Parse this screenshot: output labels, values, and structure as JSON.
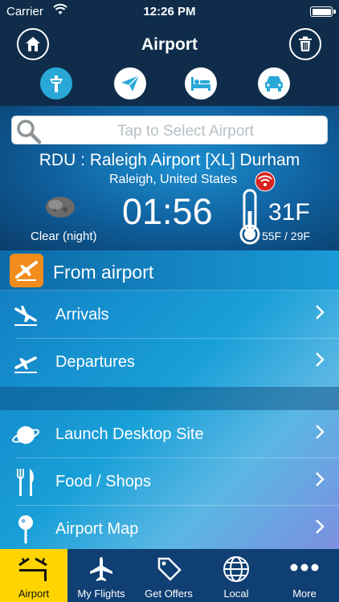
{
  "status": {
    "carrier": "Carrier",
    "time": "12:26 PM"
  },
  "header": {
    "title": "Airport"
  },
  "modes": [
    "airport-mode",
    "flight-mode",
    "hotel-mode",
    "car-mode"
  ],
  "search": {
    "placeholder": "Tap to Select Airport"
  },
  "airport": {
    "name": "RDU : Raleigh Airport [XL] Durham",
    "location": "Raleigh, United States",
    "weather": "Clear (night)",
    "local_time": "01:56",
    "temperature": "31F",
    "range": "55F / 29F"
  },
  "section": {
    "title": "From airport"
  },
  "rows": [
    {
      "label": "Arrivals",
      "icon": "arrivals-icon"
    },
    {
      "label": "Departures",
      "icon": "departures-icon"
    },
    {
      "label": "Launch Desktop Site",
      "icon": "planet-icon"
    },
    {
      "label": "Food / Shops",
      "icon": "fork-knife-icon"
    },
    {
      "label": "Airport Map",
      "icon": "map-pin-icon"
    }
  ],
  "tabs": [
    {
      "label": "Airport",
      "active": true
    },
    {
      "label": "My Flights"
    },
    {
      "label": "Get Offers"
    },
    {
      "label": "Local"
    },
    {
      "label": "More"
    }
  ],
  "colors": {
    "active_tab": "#ffd400",
    "accent": "#29a8d8",
    "section_icon": "#f28c1c"
  }
}
